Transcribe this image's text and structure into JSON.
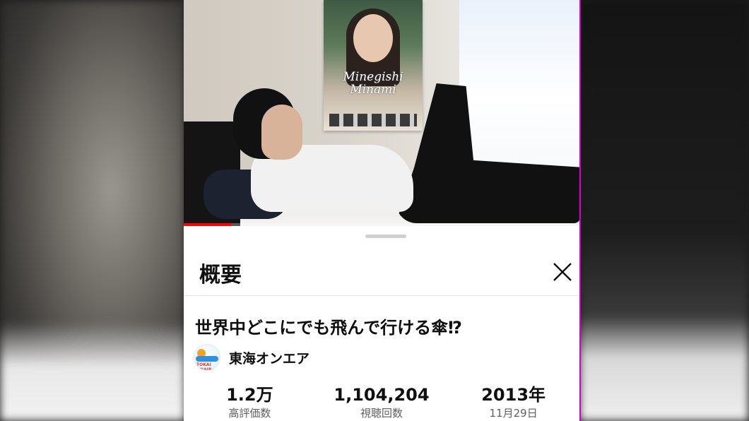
{
  "video": {
    "poster_text_line1": "Minegishi",
    "poster_text_line2": "Minami",
    "progress_fraction": 0.12,
    "progress_color": "#ff0000"
  },
  "description_panel": {
    "header_title": "概要",
    "close_icon": "close-icon",
    "video_title": "世界中どこにでも飛んで行ける傘⁉",
    "channel": {
      "name": "東海オンエア",
      "avatar_text": "TOKAI ONAIR"
    },
    "stats": [
      {
        "value": "1.2万",
        "label": "高評価数"
      },
      {
        "value": "1,104,204",
        "label": "視聴回数"
      },
      {
        "value": "2013年",
        "label": "11月29日"
      }
    ]
  },
  "colors": {
    "accent": "#ff0000",
    "frame_edge": "#d400d4",
    "text_primary": "#0f0f0f",
    "text_secondary": "#606060"
  }
}
